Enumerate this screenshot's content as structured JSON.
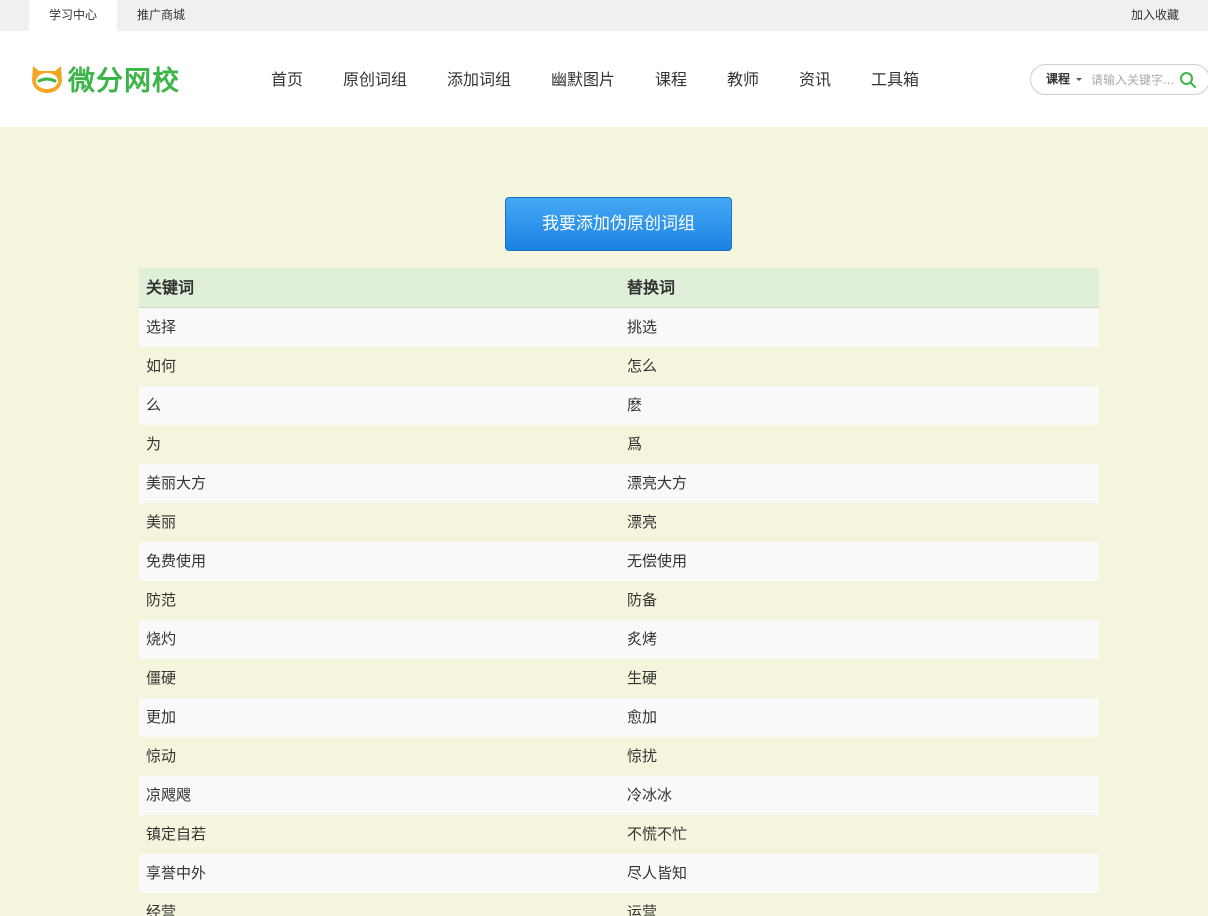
{
  "topbar": {
    "tabs": [
      "学习中心",
      "推广商城"
    ],
    "favorite": "加入收藏"
  },
  "header": {
    "logo_text": "微分网校",
    "nav": [
      "首页",
      "原创词组",
      "添加词组",
      "幽默图片",
      "课程",
      "教师",
      "资讯",
      "工具箱"
    ],
    "search": {
      "category": "课程",
      "placeholder": "请输入关键字..."
    }
  },
  "main": {
    "add_button": "我要添加伪原创词组",
    "table": {
      "headers": [
        "关键词",
        "替换词"
      ],
      "rows": [
        [
          "选择",
          "挑选"
        ],
        [
          "如何",
          "怎么"
        ],
        [
          "么",
          "麽"
        ],
        [
          "为",
          "爲"
        ],
        [
          "美丽大方",
          "漂亮大方"
        ],
        [
          "美丽",
          "漂亮"
        ],
        [
          "免费使用",
          "无偿使用"
        ],
        [
          "防范",
          "防备"
        ],
        [
          "烧灼",
          "炙烤"
        ],
        [
          "僵硬",
          "生硬"
        ],
        [
          "更加",
          "愈加"
        ],
        [
          "惊动",
          "惊扰"
        ],
        [
          "凉飕飕",
          "冷冰冰"
        ],
        [
          "镇定自若",
          "不慌不忙"
        ],
        [
          "享誉中外",
          "尽人皆知"
        ],
        [
          "经营",
          "运营"
        ]
      ]
    }
  },
  "colors": {
    "brand_green": "#3db44a",
    "logo_orange": "#f5a623",
    "button_blue": "#2b90ea",
    "table_header": "#dfefd8",
    "page_bg": "#f5f4dc"
  }
}
